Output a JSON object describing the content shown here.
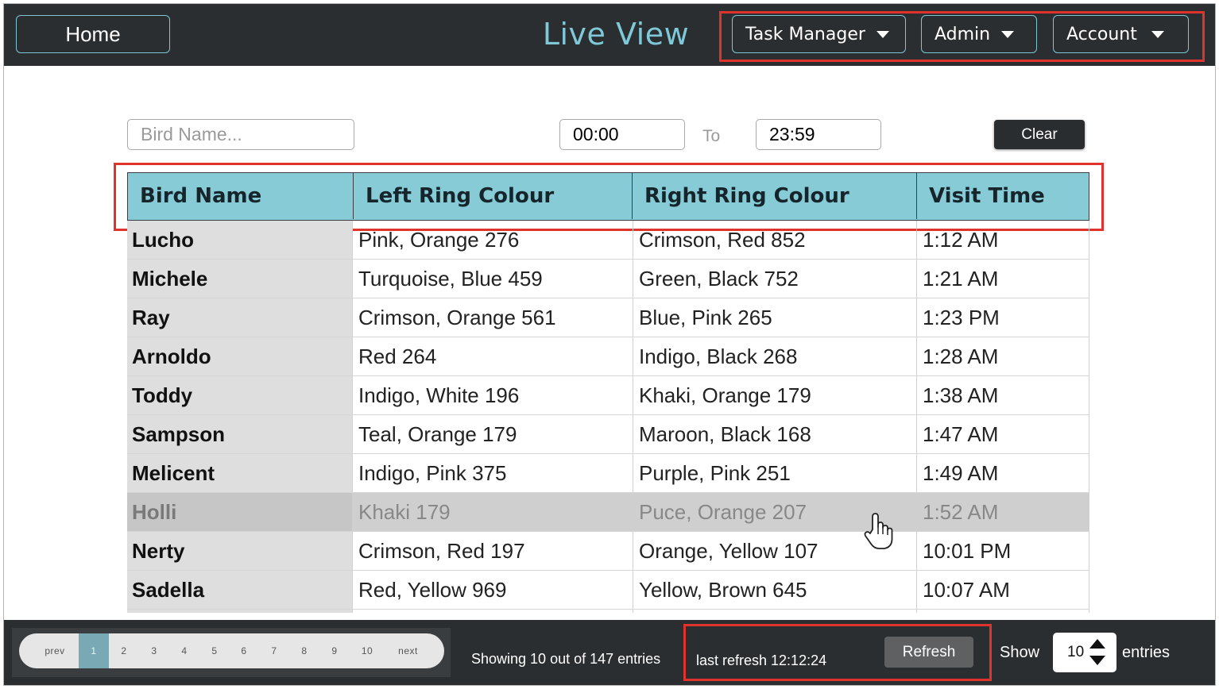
{
  "header": {
    "home_label": "Home",
    "title": "Live View",
    "nav": [
      {
        "label": "Task Manager"
      },
      {
        "label": "Admin"
      },
      {
        "label": "Account"
      }
    ]
  },
  "filters": {
    "bird_name_placeholder": "Bird Name...",
    "time_from": "00:00",
    "to_label": "To",
    "time_to": "23:59",
    "clear_label": "Clear"
  },
  "table": {
    "columns": [
      "Bird Name",
      "Left Ring Colour",
      "Right Ring Colour",
      "Visit Time"
    ],
    "rows": [
      {
        "name": "Lucho",
        "left": "Pink, Orange 276",
        "right": "Crimson, Red 852",
        "time": "1:12 AM"
      },
      {
        "name": "Michele",
        "left": "Turquoise, Blue 459",
        "right": "Green, Black 752",
        "time": "1:21 AM"
      },
      {
        "name": "Ray",
        "left": "Crimson, Orange 561",
        "right": "Blue, Pink 265",
        "time": "1:23 PM"
      },
      {
        "name": "Arnoldo",
        "left": "Red 264",
        "right": "Indigo, Black 268",
        "time": "1:28 AM"
      },
      {
        "name": "Toddy",
        "left": "Indigo, White 196",
        "right": "Khaki, Orange 179",
        "time": "1:38 AM"
      },
      {
        "name": "Sampson",
        "left": "Teal, Orange 179",
        "right": "Maroon, Black 168",
        "time": "1:47 AM"
      },
      {
        "name": "Melicent",
        "left": "Indigo, Pink 375",
        "right": "Purple, Pink 251",
        "time": "1:49 AM"
      },
      {
        "name": "Holli",
        "left": "Khaki 179",
        "right": "Puce, Orange 207",
        "time": "1:52 AM"
      },
      {
        "name": "Nerty",
        "left": "Crimson, Red 197",
        "right": "Orange, Yellow 107",
        "time": "10:01 PM"
      },
      {
        "name": "Sadella",
        "left": "Red, Yellow 969",
        "right": "Yellow, Brown 645",
        "time": "10:07 AM"
      }
    ],
    "hovered_row": "Holli"
  },
  "footer": {
    "pagination": [
      "prev",
      "1",
      "2",
      "3",
      "4",
      "5",
      "6",
      "7",
      "8",
      "9",
      "10",
      "next"
    ],
    "active_page": "1",
    "showing_text": "Showing 10 out of 147 entries",
    "last_refresh": "last refresh 12:12:24",
    "refresh_label": "Refresh",
    "show_label": "Show",
    "entries_value": "10",
    "entries_label": "entries"
  },
  "colors": {
    "accent": "#7fc8d8",
    "header_bg": "#86cbd6",
    "bar_bg": "#2b2e30",
    "highlight": "#e0332b"
  }
}
